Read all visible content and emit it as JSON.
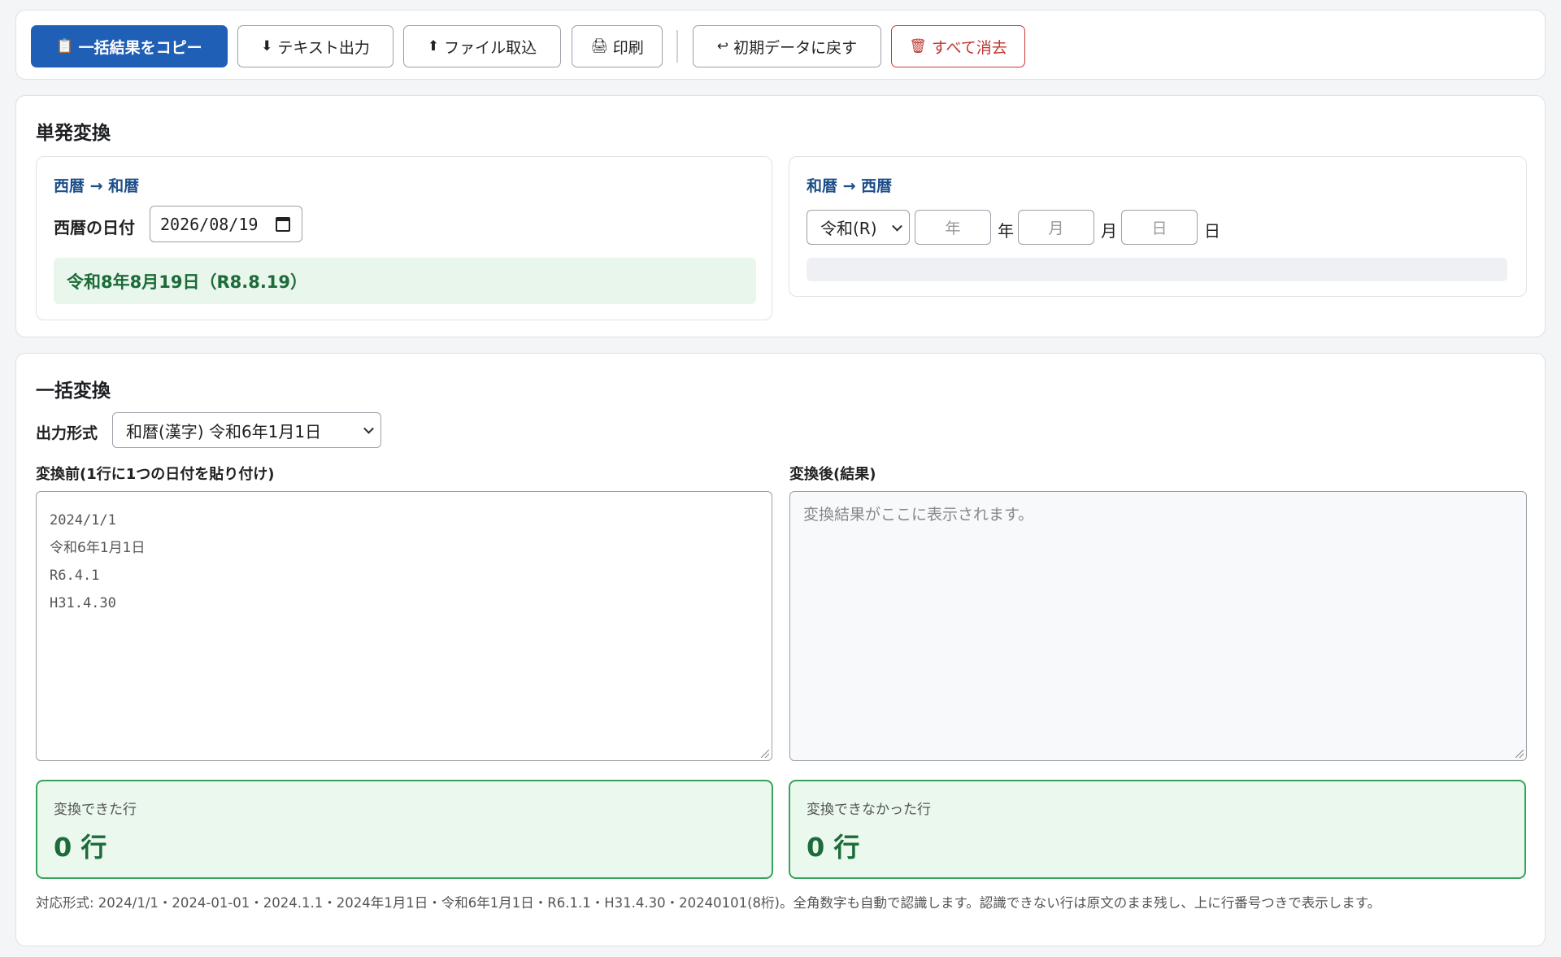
{
  "toolbar": {
    "copy_all": {
      "icon": "clipboard-icon",
      "glyph": "📋",
      "label": "一括結果をコピー"
    },
    "text_export": {
      "icon": "download-arrow-icon",
      "glyph": "⬇",
      "label": "テキスト出力"
    },
    "file_import": {
      "icon": "upload-arrow-icon",
      "glyph": "⬆",
      "label": "ファイル取込"
    },
    "print": {
      "icon": "printer-icon",
      "glyph": "🖨",
      "label": "印刷"
    },
    "reset": {
      "icon": "return-arrow-icon",
      "glyph": "↩",
      "label": "初期データに戻す"
    },
    "clear_all": {
      "icon": "trash-icon",
      "glyph": "🗑",
      "label": "すべて消去"
    }
  },
  "single": {
    "title": "単発変換",
    "to_wareki": {
      "title": "西暦 → 和暦",
      "date_label": "西暦の日付",
      "date_value": "2026/08/19",
      "result": "令和8年8月19日（R8.8.19）"
    },
    "to_seireki": {
      "title": "和暦 → 西暦",
      "era_selected": "令和(R)",
      "year_placeholder": "年",
      "year_unit": "年",
      "month_placeholder": "月",
      "month_unit": "月",
      "day_placeholder": "日",
      "day_unit": "日",
      "result": ""
    }
  },
  "batch": {
    "title": "一括変換",
    "format_label": "出力形式",
    "format_selected": "和暦(漢字) 令和6年1月1日",
    "input_label": "変換前(1行に1つの日付を貼り付け)",
    "input_lines": [
      "2024/1/1",
      "令和6年1月1日",
      "R6.4.1",
      "H31.4.30"
    ],
    "output_label": "変換後(結果)",
    "output_placeholder": "変換結果がここに表示されます。",
    "ok_label": "変換できた行",
    "ok_value": "0 行",
    "ng_label": "変換できなかった行",
    "ng_value": "0 行",
    "note": "対応形式: 2024/1/1・2024-01-01・2024.1.1・2024年1月1日・令和6年1月1日・R6.1.1・H31.4.30・20240101(8桁)。全角数字も自動で認識します。認識できない行は原文のまま残し、上に行番号つきで表示します。"
  },
  "colors": {
    "primary": "#1f5fb5",
    "danger": "#c03530",
    "success_text": "#1c6b38",
    "success_bg": "#ebf8ee",
    "heading_blue": "#1d4e89"
  }
}
